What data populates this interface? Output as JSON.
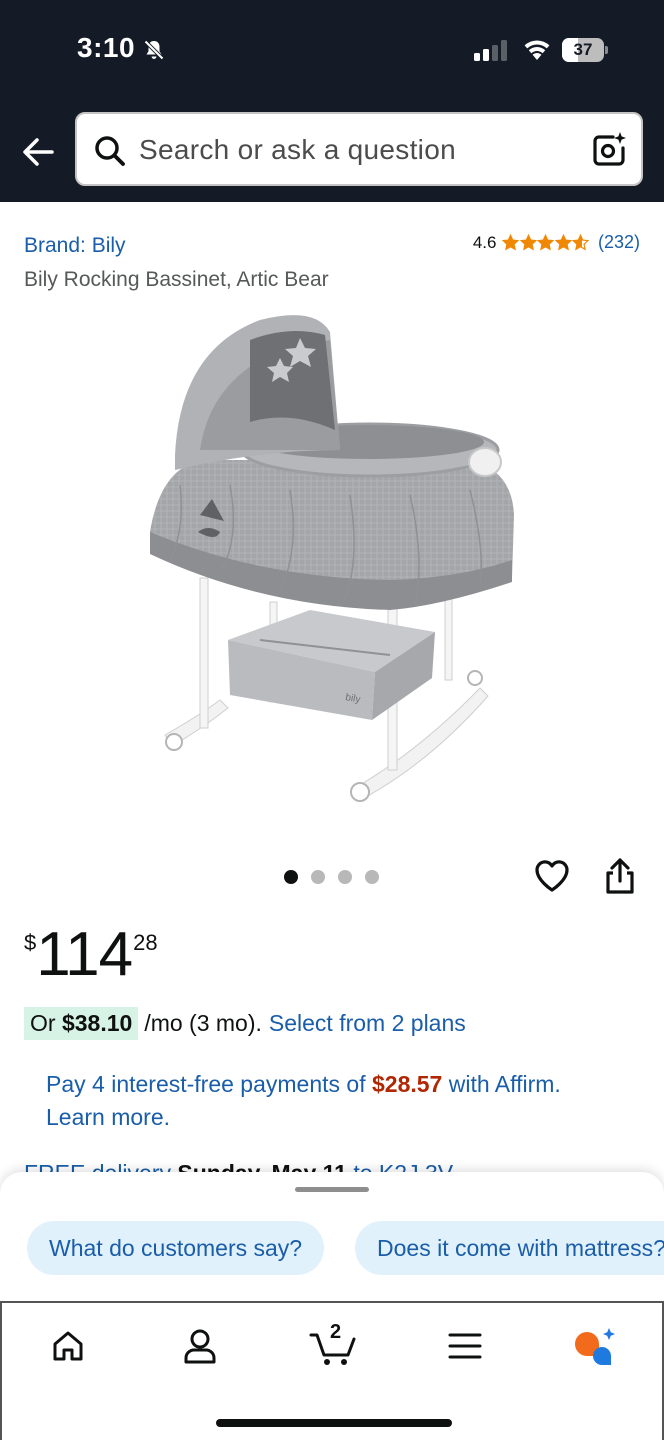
{
  "status_bar": {
    "time": "3:10",
    "battery": "37",
    "battery_level": 0.37
  },
  "header": {
    "search_placeholder": "Search or ask a question",
    "icons": [
      "back-arrow-icon",
      "search-icon",
      "camera-lens-icon"
    ]
  },
  "product": {
    "brand": "Brand: Bily",
    "title": "Bily Rocking Bassinet, Artic Bear",
    "rating_value": "4.6",
    "rating_stars": 4.6,
    "rating_count": "(232)",
    "image_count": 4,
    "active_image": 1
  },
  "price": {
    "symbol": "$",
    "whole": "114",
    "fraction": "28"
  },
  "monthly": {
    "prefix": "Or ",
    "amount": "$38.10",
    "terms": "/mo (3 mo).",
    "link": "Select from 2 plans"
  },
  "affirm": {
    "text_before": "Pay 4 interest-free payments of ",
    "amount": "$28.57",
    "text_after": " with Affirm. Learn more."
  },
  "delivery": {
    "prefix": "FREE delivery ",
    "date": "Sunday, May 11",
    "suffix": " to K2J 3V"
  },
  "suggestions": [
    {
      "label": "What do customers say?"
    },
    {
      "label": "Does it come with mattress?"
    }
  ],
  "bottom_nav": {
    "cart_count": "2",
    "items": [
      "home-icon",
      "account-icon",
      "cart-icon",
      "menu-icon",
      "rufus-icon"
    ]
  },
  "colors": {
    "header_bg": "#151b26",
    "link": "#1a5da8",
    "star": "#f08804",
    "price_accent": "#b12704",
    "badge_bg": "#d7f3e5",
    "chip_bg": "#e1f1fb"
  }
}
